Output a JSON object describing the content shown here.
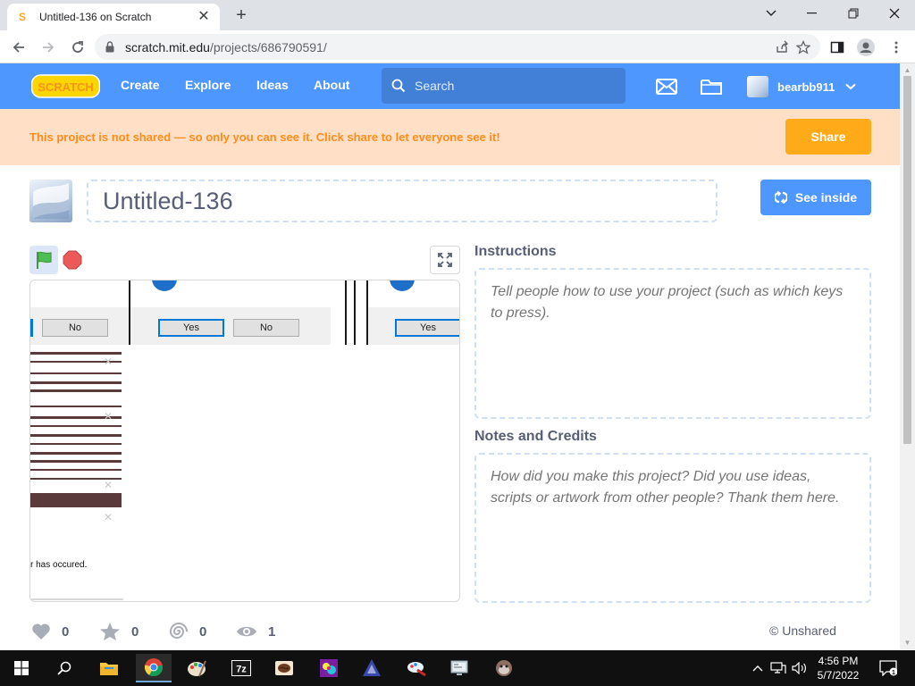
{
  "browser": {
    "tab_title": "Untitled-136 on Scratch",
    "tab_favicon": "S",
    "url_host": "scratch.mit.edu",
    "url_path": "/projects/686790591/",
    "new_tab_label": "+",
    "tab_close_label": "✕"
  },
  "scratch_nav": {
    "logo_text": "SCRATCH",
    "links": [
      "Create",
      "Explore",
      "Ideas",
      "About"
    ],
    "search_placeholder": "Search",
    "username": "bearbb911"
  },
  "banner": {
    "message": "This project is not shared — so only you can see it. Click share to let everyone see it!",
    "share_label": "Share"
  },
  "project": {
    "title": "Untitled-136",
    "see_inside_label": "See inside"
  },
  "stage_content": {
    "buttons": [
      "No",
      "Yes",
      "No",
      "Yes"
    ],
    "error_text": "r has occured."
  },
  "instructions": {
    "heading": "Instructions",
    "placeholder": "Tell people how to use your project (such as which keys to press)."
  },
  "notes": {
    "heading": "Notes and Credits",
    "placeholder": "How did you make this project? Did you use ideas, scripts or artwork from other people? Thank them here."
  },
  "stats": {
    "loves": "0",
    "favorites": "0",
    "remixes": "0",
    "views": "1",
    "share_status": "© Unshared"
  },
  "taskbar": {
    "time": "4:56 PM",
    "date": "5/7/2022",
    "notification_count": "1"
  },
  "colors": {
    "scratch_blue": "#4d97ff",
    "banner_bg": "#ffe0c7",
    "banner_text": "#ff8c1a",
    "share_orange": "#ffab19"
  }
}
